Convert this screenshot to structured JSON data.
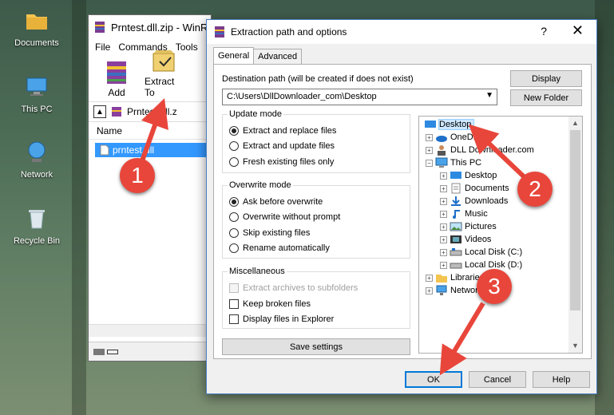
{
  "desktop": {
    "icons": [
      {
        "label": "Documents"
      },
      {
        "label": "This PC"
      },
      {
        "label": "Network"
      },
      {
        "label": "Recycle Bin"
      }
    ]
  },
  "winrar": {
    "title": "Prntest.dll.zip - WinR",
    "menu": [
      "File",
      "Commands",
      "Tools"
    ],
    "toolbar": {
      "add": "Add",
      "extract_to": "Extract To"
    },
    "path": "Prntest.dll.z",
    "column_name": "Name",
    "file": "prntest.dll"
  },
  "dialog": {
    "title": "Extraction path and options",
    "help": "?",
    "close": "✕",
    "tabs": [
      "General",
      "Advanced"
    ],
    "dest_label": "Destination path (will be created if does not exist)",
    "dest_value": "C:\\Users\\DllDownloader_com\\Desktop",
    "display_btn": "Display",
    "new_folder_btn": "New Folder",
    "update_mode": {
      "title": "Update mode",
      "options": [
        "Extract and replace files",
        "Extract and update files",
        "Fresh existing files only"
      ]
    },
    "overwrite_mode": {
      "title": "Overwrite mode",
      "options": [
        "Ask before overwrite",
        "Overwrite without prompt",
        "Skip existing files",
        "Rename automatically"
      ]
    },
    "misc": {
      "title": "Miscellaneous",
      "options": [
        "Extract archives to subfolders",
        "Keep broken files",
        "Display files in Explorer"
      ]
    },
    "save_settings": "Save settings",
    "tree": [
      {
        "label": "Desktop"
      },
      {
        "label": "OneDrive"
      },
      {
        "label": "DLL Downloader.com"
      },
      {
        "label": "This PC"
      },
      {
        "label": "Desktop"
      },
      {
        "label": "Documents"
      },
      {
        "label": "Downloads"
      },
      {
        "label": "Music"
      },
      {
        "label": "Pictures"
      },
      {
        "label": "Videos"
      },
      {
        "label": "Local Disk (C:)"
      },
      {
        "label": "Local Disk (D:)"
      },
      {
        "label": "Libraries"
      },
      {
        "label": "Network"
      }
    ],
    "ok": "OK",
    "cancel": "Cancel",
    "help_btn": "Help"
  },
  "callouts": [
    "1",
    "2",
    "3"
  ],
  "colors": {
    "callout": "#e8463b",
    "selection": "#3399ff",
    "tree_selection": "#cce8ff"
  }
}
